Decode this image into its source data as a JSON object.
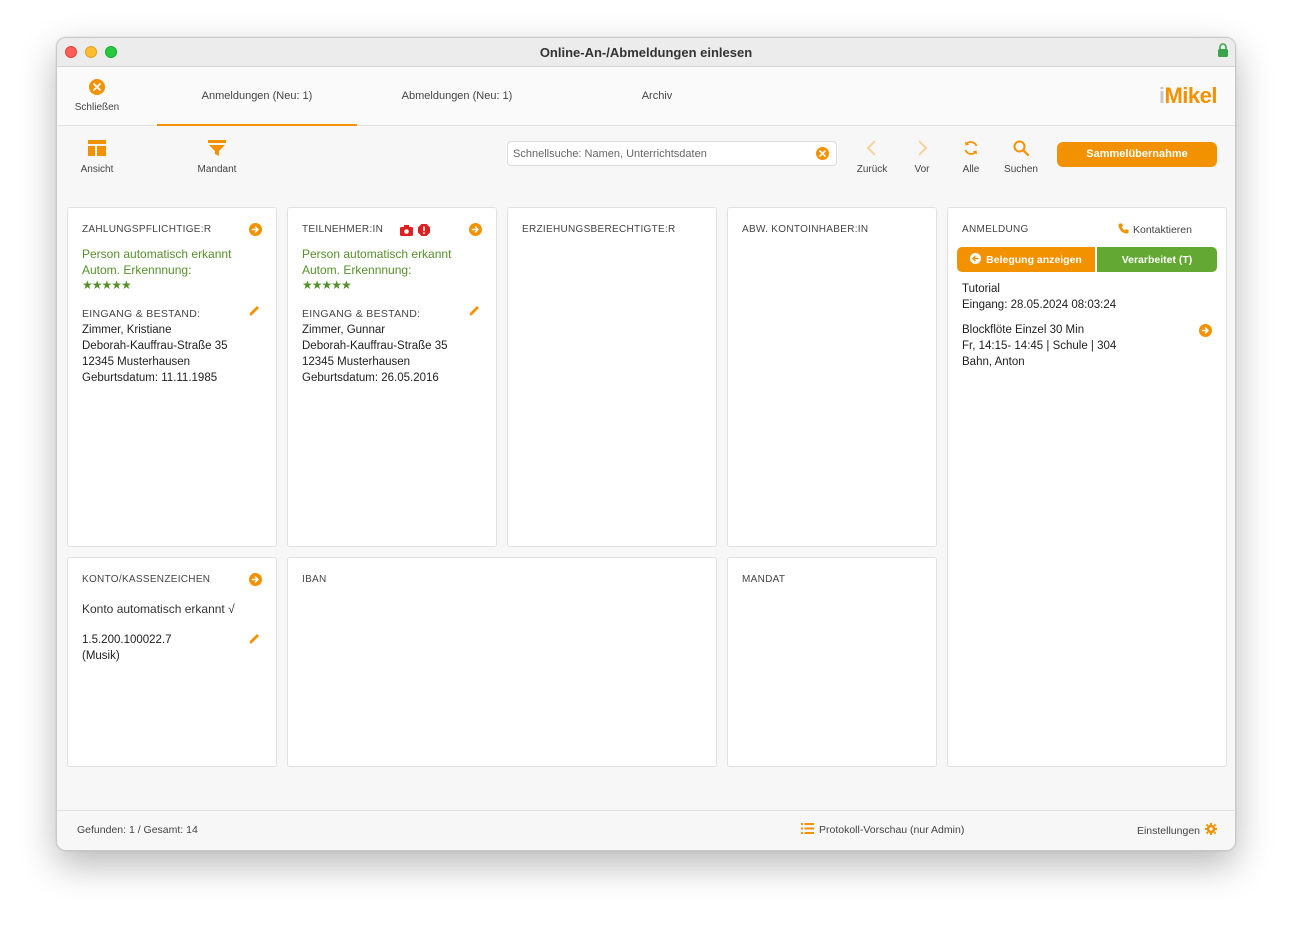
{
  "window": {
    "title": "Online-An-/Abmeldungen einlesen"
  },
  "topbar": {
    "close_label": "Schließen",
    "tabs": [
      {
        "label": "Anmeldungen (Neu: 1)",
        "active": true
      },
      {
        "label": "Abmeldungen (Neu: 1)",
        "active": false
      },
      {
        "label": "Archiv",
        "active": false
      }
    ],
    "logo": {
      "prefix": "i",
      "text": "Mikel"
    }
  },
  "toolbar": {
    "view_label": "Ansicht",
    "client_label": "Mandant",
    "search_placeholder": "Schnellsuche: Namen, Unterrichtsdaten",
    "search_value": "",
    "back_label": "Zurück",
    "forward_label": "Vor",
    "all_label": "Alle",
    "find_label": "Suchen",
    "bulk_label": "Sammelübernahme"
  },
  "payer": {
    "heading": "ZAHLUNGSPFLICHTIGE:R",
    "status_line1": "Person automatisch erkannt",
    "status_line2": "Autom. Erkennnung:",
    "stars": "★★★★★",
    "entry_label": "EINGANG & BESTAND:",
    "name": "Zimmer, Kristiane",
    "street": "Deborah-Kauffrau-Straße 35",
    "city": "12345 Musterhausen",
    "birthdate": "Geburtsdatum: 11.11.1985"
  },
  "participant": {
    "heading": "TEILNEHMER:IN",
    "status_line1": "Person automatisch erkannt",
    "status_line2": "Autom. Erkennnung:",
    "stars": "★★★★★",
    "entry_label": "EINGANG & BESTAND:",
    "name": "Zimmer, Gunnar",
    "street": "Deborah-Kauffrau-Straße 35",
    "city": "12345 Musterhausen",
    "birthdate": "Geburtsdatum: 26.05.2016"
  },
  "guardian": {
    "heading": "ERZIEHUNGSBERECHTIGTE:R"
  },
  "account_holder": {
    "heading": "ABW. KONTOINHABER:IN"
  },
  "registration": {
    "heading": "ANMELDUNG",
    "contact_label": "Kontaktieren",
    "show_booking_label": "Belegung anzeigen",
    "processed_label": "Verarbeitet (T)",
    "source": "Tutorial",
    "received": "Eingang: 28.05.2024 08:03:24",
    "course": "Blockflöte Einzel 30 Min",
    "schedule": "Fr, 14:15- 14:45 | Schule | 304",
    "teacher": "Bahn, Anton"
  },
  "account": {
    "heading": "KONTO/KASSENZEICHEN",
    "status": "Konto automatisch erkannt √",
    "number": "1.5.200.100022.7",
    "note": "(Musik)"
  },
  "iban": {
    "heading": "IBAN"
  },
  "mandate": {
    "heading": "MANDAT"
  },
  "statusbar": {
    "count": "Gefunden: 1 / Gesamt: 14",
    "log_preview": "Protokoll-Vorschau (nur Admin)",
    "settings": "Einstellungen"
  },
  "colors": {
    "accent": "#f39200",
    "success": "#63a832",
    "recognized_text": "#55902a",
    "alert": "#e02020"
  }
}
